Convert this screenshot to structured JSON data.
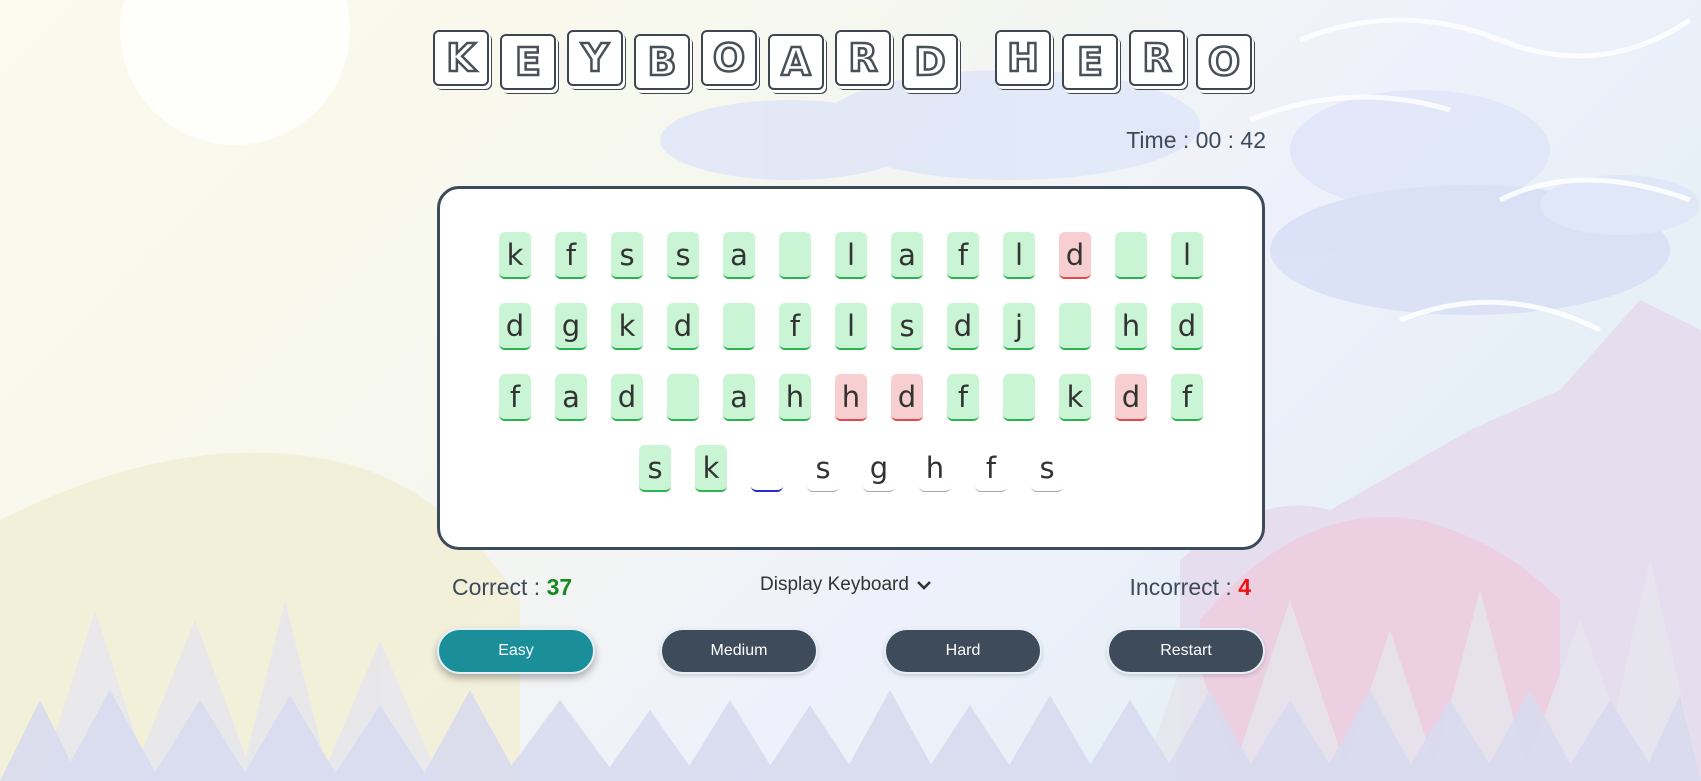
{
  "title": {
    "letters": [
      "K",
      "E",
      "Y",
      "B",
      "O",
      "A",
      "R",
      "D",
      "H",
      "E",
      "R",
      "O"
    ]
  },
  "timer": {
    "label": "Time : 00 : 42"
  },
  "board": {
    "rows": [
      [
        {
          "char": "k",
          "state": "correct"
        },
        {
          "char": "f",
          "state": "correct"
        },
        {
          "char": "s",
          "state": "correct"
        },
        {
          "char": "s",
          "state": "correct"
        },
        {
          "char": "a",
          "state": "correct"
        },
        {
          "char": "",
          "state": "correct"
        },
        {
          "char": "l",
          "state": "correct"
        },
        {
          "char": "a",
          "state": "correct"
        },
        {
          "char": "f",
          "state": "correct"
        },
        {
          "char": "l",
          "state": "correct"
        },
        {
          "char": "d",
          "state": "incorrect"
        },
        {
          "char": "",
          "state": "correct"
        },
        {
          "char": "l",
          "state": "correct"
        }
      ],
      [
        {
          "char": "d",
          "state": "correct"
        },
        {
          "char": "g",
          "state": "correct"
        },
        {
          "char": "k",
          "state": "correct"
        },
        {
          "char": "d",
          "state": "correct"
        },
        {
          "char": "",
          "state": "correct"
        },
        {
          "char": "f",
          "state": "correct"
        },
        {
          "char": "l",
          "state": "correct"
        },
        {
          "char": "s",
          "state": "correct"
        },
        {
          "char": "d",
          "state": "correct"
        },
        {
          "char": "j",
          "state": "correct"
        },
        {
          "char": "",
          "state": "correct"
        },
        {
          "char": "h",
          "state": "correct"
        },
        {
          "char": "d",
          "state": "correct"
        }
      ],
      [
        {
          "char": "f",
          "state": "correct"
        },
        {
          "char": "a",
          "state": "correct"
        },
        {
          "char": "d",
          "state": "correct"
        },
        {
          "char": "",
          "state": "correct"
        },
        {
          "char": "a",
          "state": "correct"
        },
        {
          "char": "h",
          "state": "correct"
        },
        {
          "char": "h",
          "state": "incorrect"
        },
        {
          "char": "d",
          "state": "incorrect"
        },
        {
          "char": "f",
          "state": "correct"
        },
        {
          "char": "",
          "state": "correct"
        },
        {
          "char": "k",
          "state": "correct"
        },
        {
          "char": "d",
          "state": "incorrect"
        },
        {
          "char": "f",
          "state": "correct"
        }
      ],
      [
        {
          "char": "s",
          "state": "correct"
        },
        {
          "char": "k",
          "state": "correct"
        },
        {
          "char": "",
          "state": "current"
        },
        {
          "char": "s",
          "state": "pending"
        },
        {
          "char": "g",
          "state": "pending"
        },
        {
          "char": "h",
          "state": "pending"
        },
        {
          "char": "f",
          "state": "pending"
        },
        {
          "char": "s",
          "state": "pending"
        }
      ]
    ]
  },
  "stats": {
    "correct_label": "Correct : ",
    "correct_value": "37",
    "incorrect_label": "Incorrect : ",
    "incorrect_value": "4"
  },
  "display_keyboard": {
    "label": "Display Keyboard",
    "icon": "chevron-down-icon"
  },
  "buttons": {
    "easy": "Easy",
    "medium": "Medium",
    "hard": "Hard",
    "restart": "Restart",
    "active": "easy"
  },
  "colors": {
    "correct_bg": "#c9f5d4",
    "incorrect_bg": "#f7cfd0",
    "active_button": "#1a8e99",
    "button": "#3d4b5b",
    "correct_count": "#178a1f",
    "incorrect_count": "#ee1111"
  }
}
